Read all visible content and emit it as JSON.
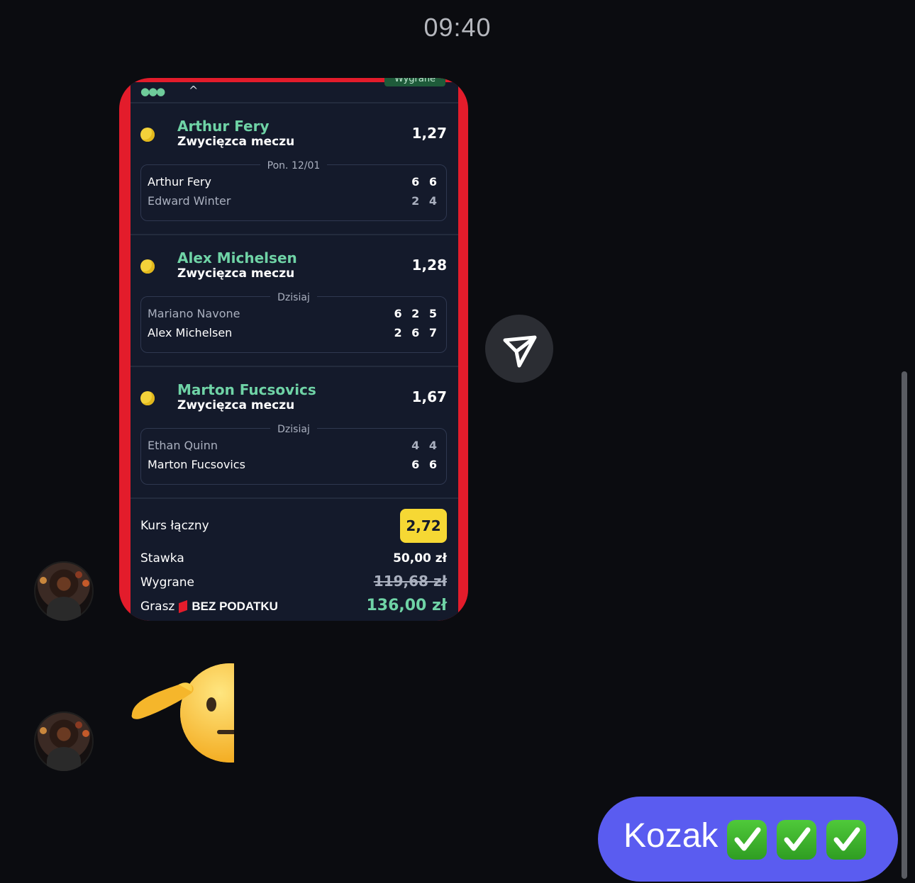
{
  "timestamp": "09:40",
  "bet_slip": {
    "status_badge": "Wygrane",
    "legs": [
      {
        "pick": "Arthur Fery",
        "market": "Zwycięzca meczu",
        "odds": "1,27",
        "date": "Pon. 12/01",
        "players": [
          {
            "name": "Arthur Fery",
            "score": "6 6",
            "winner": true
          },
          {
            "name": "Edward Winter",
            "score": "2 4",
            "winner": false
          }
        ]
      },
      {
        "pick": "Alex Michelsen",
        "market": "Zwycięzca meczu",
        "odds": "1,28",
        "date": "Dzisiaj",
        "players": [
          {
            "name": "Mariano Navone",
            "score": "6 2 5",
            "winner": false
          },
          {
            "name": "Alex Michelsen",
            "score": "2 6 7",
            "winner": true
          }
        ]
      },
      {
        "pick": "Marton Fucsovics",
        "market": "Zwycięzca meczu",
        "odds": "1,67",
        "date": "Dzisiaj",
        "players": [
          {
            "name": "Ethan Quinn",
            "score": "4 4",
            "winner": false
          },
          {
            "name": "Marton Fucsovics",
            "score": "6 6",
            "winner": true
          }
        ]
      }
    ],
    "summary": {
      "total_odds_label": "Kurs łączny",
      "total_odds": "2,72",
      "stake_label": "Stawka",
      "stake": "50,00 zł",
      "winnings_label": "Wygrane",
      "winnings_old": "119,68 zł",
      "tax_label": "Grasz",
      "tax_free_text": "BEZ PODATKU",
      "winnings_new": "136,00 zł"
    }
  },
  "message": {
    "text": "Kozak",
    "checkmarks": 3
  },
  "icons": {
    "share": "share-send-icon",
    "emoji": "saluting-face-emoji",
    "check": "check-mark-button-emoji"
  },
  "colors": {
    "background": "#0b0c10",
    "bubble": "#5a5cf0",
    "slip_border": "#e31c2b",
    "accent_green": "#6fd3a6",
    "odds_badge": "#f6d834"
  }
}
